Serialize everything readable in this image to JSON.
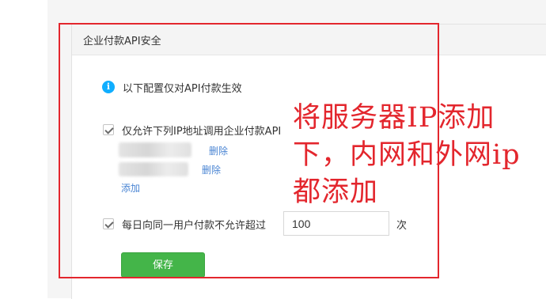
{
  "panel": {
    "title": "企业付款API安全"
  },
  "notice": {
    "icon": "info-icon",
    "text": "以下配置仅对API付款生效"
  },
  "ip_whitelist": {
    "checked": true,
    "label": "仅允许下列IP地址调用企业付款API",
    "entries": [
      {
        "ip": "",
        "delete_label": "删除"
      },
      {
        "ip": "",
        "delete_label": "删除"
      }
    ],
    "add_label": "添加"
  },
  "daily_limit": {
    "checked": true,
    "label": "每日向同一用户付款不允许超过",
    "value": "100",
    "unit": "次"
  },
  "save_label": "保存",
  "annotation": {
    "lines": [
      "将服务器IP添加",
      "下，内网和外网ip",
      "都添加"
    ],
    "color": "#e3262d"
  },
  "colors": {
    "accent_green": "#44b549",
    "link_blue": "#4a85d3",
    "info_blue": "#10aeff"
  }
}
